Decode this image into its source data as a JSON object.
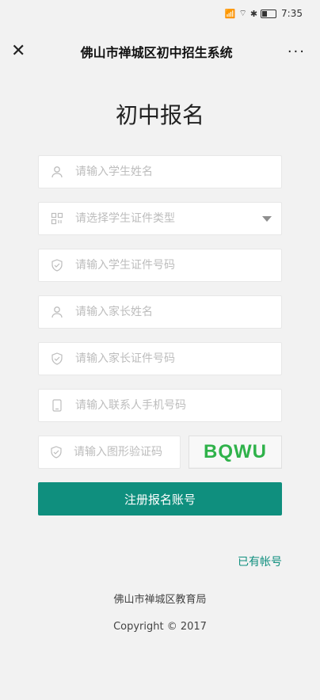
{
  "status": {
    "time": "7:35"
  },
  "nav": {
    "title": "佛山市禅城区初中招生系统",
    "more": "···"
  },
  "page": {
    "title": "初中报名"
  },
  "form": {
    "student_name_placeholder": "请输入学生姓名",
    "student_id_type_placeholder": "请选择学生证件类型",
    "student_id_placeholder": "请输入学生证件号码",
    "parent_name_placeholder": "请输入家长姓名",
    "parent_id_placeholder": "请输入家长证件号码",
    "phone_placeholder": "请输入联系人手机号码",
    "captcha_placeholder": "请输入图形验证码",
    "captcha_text": "BQWU",
    "submit_label": "注册报名账号"
  },
  "links": {
    "have_account": "已有帐号"
  },
  "footer": {
    "org": "佛山市禅城区教育局",
    "copyright": "Copyright © 2017"
  },
  "colors": {
    "accent": "#0f8f7e",
    "captcha": "#2fb24a",
    "background": "#f2f2f2"
  }
}
